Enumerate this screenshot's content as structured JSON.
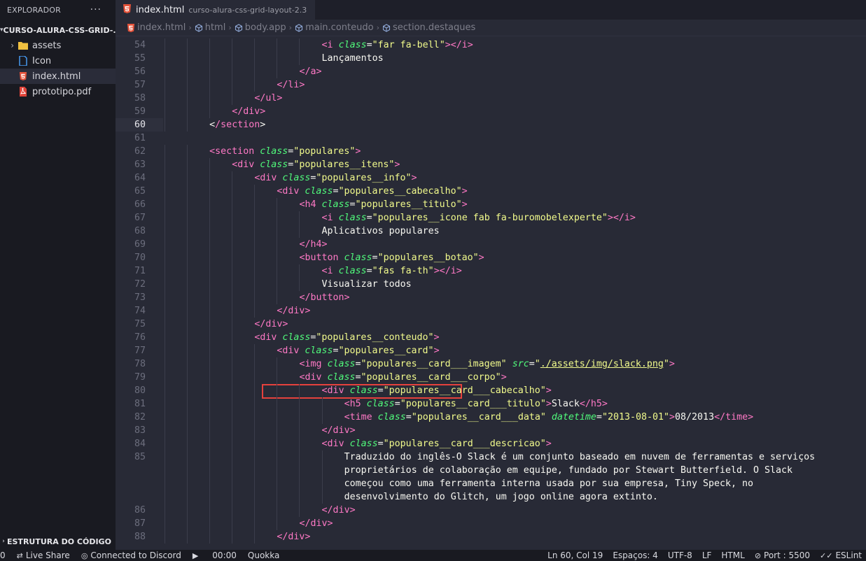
{
  "sidebar": {
    "title": "EXPLORADOR",
    "more": "···",
    "folder": "CURSO-ALURA-CSS-GRID-...",
    "items": [
      {
        "label": "assets",
        "icon": "folder-icon",
        "has_arrow": true
      },
      {
        "label": "Icon",
        "icon": "file-icon"
      },
      {
        "label": "index.html",
        "icon": "html5-icon",
        "active": true
      },
      {
        "label": "prototipo.pdf",
        "icon": "pdf-icon"
      }
    ],
    "outline": "ESTRUTURA DO CÓDIGO"
  },
  "tab": {
    "name": "index.html",
    "description": "curso-alura-css-grid-layout-2.3"
  },
  "breadcrumb": [
    "index.html",
    "html",
    "body.app",
    "main.conteudo",
    "section.destaques"
  ],
  "editor": {
    "current_line": "60",
    "lines": [
      {
        "n": "54",
        "i": 7,
        "h": [
          [
            "t",
            "<i "
          ],
          [
            "a",
            "class"
          ],
          [
            "p",
            "="
          ],
          [
            "s",
            "\"far fa-bell\""
          ],
          [
            "t",
            ">"
          ],
          [
            "t",
            "</i>"
          ]
        ]
      },
      {
        "n": "55",
        "i": 7,
        "h": [
          [
            "p",
            "Lançamentos"
          ]
        ]
      },
      {
        "n": "56",
        "i": 6,
        "h": [
          [
            "t",
            "</a>"
          ]
        ]
      },
      {
        "n": "57",
        "i": 5,
        "h": [
          [
            "t",
            "</li>"
          ]
        ]
      },
      {
        "n": "58",
        "i": 4,
        "h": [
          [
            "t",
            "</ul>"
          ]
        ]
      },
      {
        "n": "59",
        "i": 3,
        "h": [
          [
            "t",
            "</div>"
          ]
        ]
      },
      {
        "n": "60",
        "i": 2,
        "h": [
          [
            "p",
            "<"
          ],
          [
            "t",
            "/section"
          ],
          [
            "p",
            ">"
          ]
        ]
      },
      {
        "n": "61",
        "i": 0,
        "h": []
      },
      {
        "n": "62",
        "i": 2,
        "h": [
          [
            "t",
            "<section "
          ],
          [
            "a",
            "class"
          ],
          [
            "p",
            "="
          ],
          [
            "s",
            "\"populares\""
          ],
          [
            "t",
            ">"
          ]
        ]
      },
      {
        "n": "63",
        "i": 3,
        "h": [
          [
            "t",
            "<div "
          ],
          [
            "a",
            "class"
          ],
          [
            "p",
            "="
          ],
          [
            "s",
            "\"populares__itens\""
          ],
          [
            "t",
            ">"
          ]
        ]
      },
      {
        "n": "64",
        "i": 4,
        "h": [
          [
            "t",
            "<div "
          ],
          [
            "a",
            "class"
          ],
          [
            "p",
            "="
          ],
          [
            "s",
            "\"populares__info\""
          ],
          [
            "t",
            ">"
          ]
        ]
      },
      {
        "n": "65",
        "i": 5,
        "h": [
          [
            "t",
            "<div "
          ],
          [
            "a",
            "class"
          ],
          [
            "p",
            "="
          ],
          [
            "s",
            "\"populares__cabecalho\""
          ],
          [
            "t",
            ">"
          ]
        ]
      },
      {
        "n": "66",
        "i": 6,
        "h": [
          [
            "t",
            "<h4 "
          ],
          [
            "a",
            "class"
          ],
          [
            "p",
            "="
          ],
          [
            "s",
            "\"populares__titulo\""
          ],
          [
            "t",
            ">"
          ]
        ]
      },
      {
        "n": "67",
        "i": 7,
        "h": [
          [
            "t",
            "<i "
          ],
          [
            "a",
            "class"
          ],
          [
            "p",
            "="
          ],
          [
            "s",
            "\"populares__icone fab fa-buromobelexperte\""
          ],
          [
            "t",
            ">"
          ],
          [
            "t",
            "</i>"
          ]
        ]
      },
      {
        "n": "68",
        "i": 7,
        "h": [
          [
            "p",
            "Aplicativos populares"
          ]
        ]
      },
      {
        "n": "69",
        "i": 6,
        "h": [
          [
            "t",
            "</h4>"
          ]
        ]
      },
      {
        "n": "70",
        "i": 6,
        "h": [
          [
            "t",
            "<button "
          ],
          [
            "a",
            "class"
          ],
          [
            "p",
            "="
          ],
          [
            "s",
            "\"populares__botao\""
          ],
          [
            "t",
            ">"
          ]
        ]
      },
      {
        "n": "71",
        "i": 7,
        "h": [
          [
            "t",
            "<i "
          ],
          [
            "a",
            "class"
          ],
          [
            "p",
            "="
          ],
          [
            "s",
            "\"fas fa-th\""
          ],
          [
            "t",
            ">"
          ],
          [
            "t",
            "</i>"
          ]
        ]
      },
      {
        "n": "72",
        "i": 7,
        "h": [
          [
            "p",
            "Visualizar todos"
          ]
        ]
      },
      {
        "n": "73",
        "i": 6,
        "h": [
          [
            "t",
            "</button>"
          ]
        ]
      },
      {
        "n": "74",
        "i": 5,
        "h": [
          [
            "t",
            "</div>"
          ]
        ]
      },
      {
        "n": "75",
        "i": 4,
        "h": [
          [
            "t",
            "</div>"
          ]
        ]
      },
      {
        "n": "76",
        "i": 4,
        "h": [
          [
            "t",
            "<div "
          ],
          [
            "a",
            "class"
          ],
          [
            "p",
            "="
          ],
          [
            "s",
            "\"populares__conteudo\""
          ],
          [
            "t",
            ">"
          ]
        ]
      },
      {
        "n": "77",
        "i": 5,
        "h": [
          [
            "t",
            "<div "
          ],
          [
            "a",
            "class"
          ],
          [
            "p",
            "="
          ],
          [
            "s",
            "\"populares__card\""
          ],
          [
            "t",
            ">"
          ]
        ]
      },
      {
        "n": "78",
        "i": 6,
        "h": [
          [
            "t",
            "<img "
          ],
          [
            "a",
            "class"
          ],
          [
            "p",
            "="
          ],
          [
            "s",
            "\"populares__card___imagem\""
          ],
          [
            "p",
            " "
          ],
          [
            "a",
            "src"
          ],
          [
            "p",
            "="
          ],
          [
            "s",
            "\""
          ],
          [
            "su",
            "./assets/img/slack.png"
          ],
          [
            "s",
            "\""
          ],
          [
            "t",
            ">"
          ]
        ]
      },
      {
        "n": "79",
        "i": 6,
        "h": [
          [
            "t",
            "<div "
          ],
          [
            "a",
            "class"
          ],
          [
            "p",
            "="
          ],
          [
            "s",
            "\"populares__card___corpo\""
          ],
          [
            "t",
            ">"
          ]
        ]
      },
      {
        "n": "80",
        "i": 7,
        "h": [
          [
            "t",
            "<div "
          ],
          [
            "a",
            "class"
          ],
          [
            "p",
            "="
          ],
          [
            "s",
            "\"populares__card___cabecalho\""
          ],
          [
            "t",
            ">"
          ]
        ]
      },
      {
        "n": "81",
        "i": 8,
        "h": [
          [
            "t",
            "<h5 "
          ],
          [
            "a",
            "class"
          ],
          [
            "p",
            "="
          ],
          [
            "s",
            "\"populares__card___titulo\""
          ],
          [
            "t",
            ">"
          ],
          [
            "p",
            "Slack"
          ],
          [
            "t",
            "</h5>"
          ]
        ]
      },
      {
        "n": "82",
        "i": 8,
        "h": [
          [
            "t",
            "<time "
          ],
          [
            "a",
            "class"
          ],
          [
            "p",
            "="
          ],
          [
            "s",
            "\"populares__card___data\""
          ],
          [
            "p",
            " "
          ],
          [
            "a",
            "datetime"
          ],
          [
            "p",
            "="
          ],
          [
            "s",
            "\"2013-08-01\""
          ],
          [
            "t",
            ">"
          ],
          [
            "p",
            "08/2013"
          ],
          [
            "t",
            "</time>"
          ]
        ]
      },
      {
        "n": "83",
        "i": 7,
        "h": [
          [
            "t",
            "</div>"
          ]
        ]
      },
      {
        "n": "84",
        "i": 7,
        "h": [
          [
            "t",
            "<div "
          ],
          [
            "a",
            "class"
          ],
          [
            "p",
            "="
          ],
          [
            "s",
            "\"populares__card___descricao\""
          ],
          [
            "t",
            ">"
          ]
        ]
      },
      {
        "n": "85",
        "i": 8,
        "h": [
          [
            "p",
            "Traduzido do inglês-O Slack é um conjunto baseado em nuvem de ferramentas e serviços"
          ]
        ]
      },
      {
        "n": "",
        "i": 8,
        "h": [
          [
            "p",
            "proprietários de colaboração em equipe, fundado por Stewart Butterfield. O Slack"
          ]
        ]
      },
      {
        "n": "",
        "i": 8,
        "h": [
          [
            "p",
            "começou como uma ferramenta interna usada por sua empresa, Tiny Speck, no"
          ]
        ]
      },
      {
        "n": "",
        "i": 8,
        "h": [
          [
            "p",
            "desenvolvimento do Glitch, um jogo online agora extinto."
          ]
        ]
      },
      {
        "n": "86",
        "i": 7,
        "h": [
          [
            "t",
            "</div>"
          ]
        ]
      },
      {
        "n": "87",
        "i": 6,
        "h": [
          [
            "t",
            "</div>"
          ]
        ]
      },
      {
        "n": "88",
        "i": 5,
        "h": [
          [
            "t",
            "</div>"
          ]
        ]
      }
    ]
  },
  "status": {
    "left": [
      {
        "label": "0",
        "icon": ""
      },
      {
        "label": "Live Share",
        "icon": "live-share-icon"
      },
      {
        "label": "Connected to Discord",
        "icon": "discord-icon"
      },
      {
        "label": "",
        "icon": "play-icon"
      },
      {
        "label": "00:00",
        "icon": ""
      },
      {
        "label": "Quokka",
        "icon": ""
      }
    ],
    "right": [
      {
        "label": "Ln 60, Col 19"
      },
      {
        "label": "Espaços: 4"
      },
      {
        "label": "UTF-8"
      },
      {
        "label": "LF"
      },
      {
        "label": "HTML"
      },
      {
        "label": "Port : 5500",
        "icon": "port-icon"
      },
      {
        "label": "ESLint",
        "icon": "check-all-icon"
      }
    ]
  },
  "colors": {
    "tag": "#ff79c6",
    "attribute": "#50fa7b",
    "string": "#f1fa8c",
    "text": "#f8f8f2",
    "highlight_box": "#e5413d"
  }
}
